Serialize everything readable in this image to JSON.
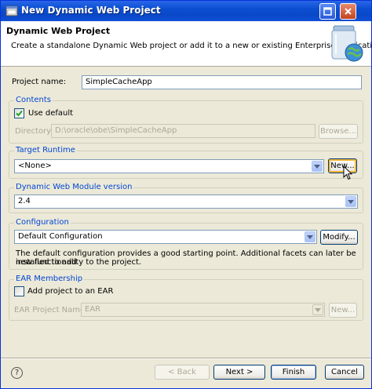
{
  "window": {
    "title": "New Dynamic Web Project"
  },
  "banner": {
    "title": "Dynamic Web Project",
    "description": "Create a standalone Dynamic Web project or add it to a new or existing Enterprise Application."
  },
  "project_name": {
    "label": "Project name:",
    "value": "SimpleCacheApp"
  },
  "contents": {
    "title": "Contents",
    "use_default_label": "Use default",
    "use_default_checked": true,
    "directory_label": "Directory:",
    "directory_value": "D:\\oracle\\obe\\SimpleCacheApp",
    "browse_label": "Browse..."
  },
  "target_runtime": {
    "title": "Target Runtime",
    "selected": "<None>",
    "new_label": "New..."
  },
  "web_module": {
    "title": "Dynamic Web Module version",
    "selected": "2.4"
  },
  "configuration": {
    "title": "Configuration",
    "selected": "Default Configuration",
    "modify_label": "Modify...",
    "info_line1": "The default configuration provides a good starting point. Additional facets can later be installed to add",
    "info_line2": "new functionality to the project."
  },
  "ear": {
    "title": "EAR Membership",
    "add_label": "Add project to an EAR",
    "add_checked": false,
    "project_name_label": "EAR Project Name:",
    "project_name_value": "EAR",
    "new_label": "New..."
  },
  "footer": {
    "help_symbol": "?",
    "back_label": "< Back",
    "next_label": "Next >",
    "finish_label": "Finish",
    "cancel_label": "Cancel"
  },
  "colors": {
    "titlebar": "#0a4fd0",
    "group_title": "#0046d5",
    "dialog_bg": "#ece9d8"
  }
}
